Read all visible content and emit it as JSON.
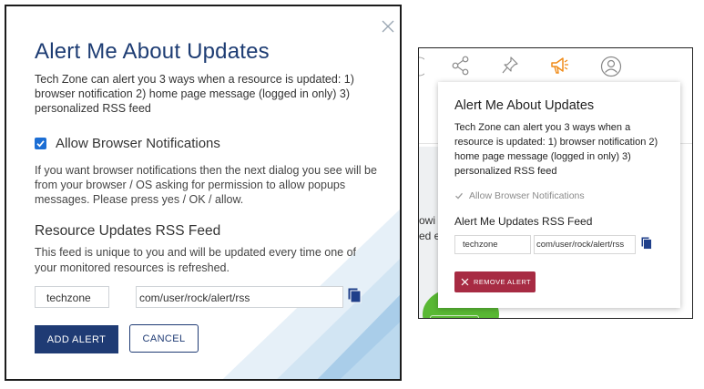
{
  "left_dialog": {
    "title": "Alert Me About Updates",
    "description": "Tech Zone can alert you 3 ways when a resource is updated: 1) browser notification 2) home page message (logged in only) 3) personalized RSS feed",
    "checkbox_label": "Allow Browser Notifications",
    "checkbox_checked": true,
    "permission_text": "If you want browser notifications then the next dialog you see will be from your browser / OS asking for permission to allow popups messages. Please press yes / OK / allow.",
    "rss_title": "Resource Updates RSS Feed",
    "rss_description": "This feed is unique to you and will be updated every time one of your monitored resources is refreshed.",
    "rss_user": "techzone",
    "rss_url": "com/user/rock/alert/rss",
    "add_button": "ADD ALERT",
    "cancel_button": "CANCEL",
    "icons": [
      "close-icon",
      "copy-icon",
      "check-icon"
    ]
  },
  "right_popup": {
    "nav_icons": [
      "share-icon",
      "pin-icon",
      "megaphone-icon",
      "user-circle-icon"
    ],
    "background_text_1": "owi",
    "background_text_2": "ed e",
    "title": "Alert Me About Updates",
    "description": "Tech Zone can alert you 3 ways when a resource is updated: 1) browser notification 2) home page message (logged in only) 3) personalized RSS feed",
    "checkbox_label": "Allow Browser Notifications",
    "checkbox_checked": true,
    "rss_title": "Alert Me Updates RSS Feed",
    "rss_user": "techzone",
    "rss_url": "com/user/rock/alert/rss",
    "remove_button": "REMOVE ALERT"
  },
  "colors": {
    "title_blue": "#1d3c73",
    "checkbox_blue": "#1c6ed4",
    "primary_button": "#1f3b74",
    "remove_button": "#a72b43",
    "megaphone_orange": "#f08c1a",
    "copy_icon_blue": "#1f3f8a"
  }
}
